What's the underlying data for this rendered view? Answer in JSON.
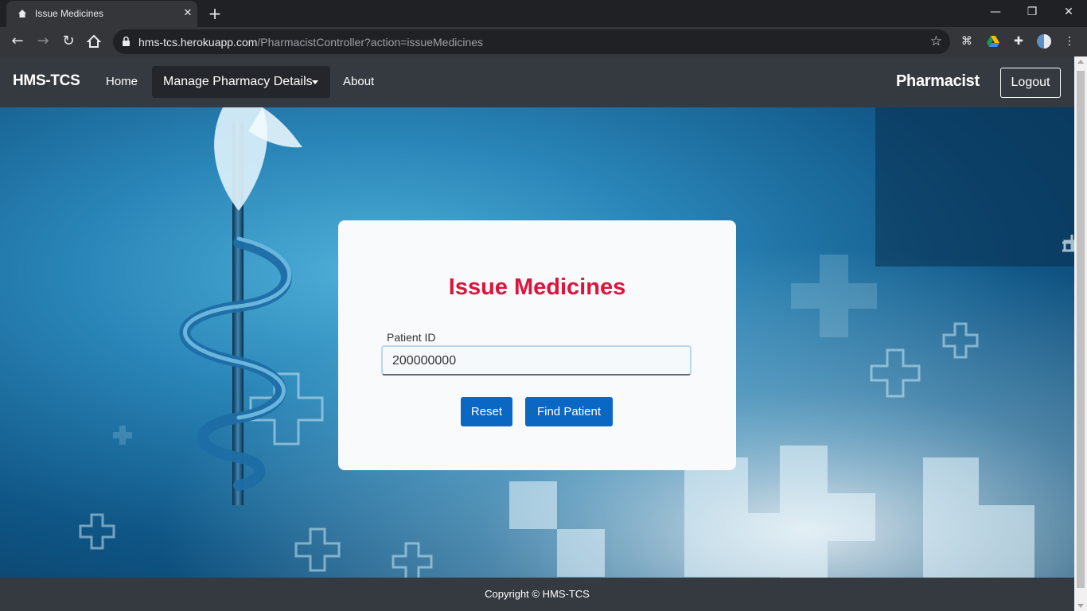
{
  "browser": {
    "tab_title": "Issue Medicines",
    "url_host": "hms-tcs.herokuapp.com",
    "url_path": "/PharmacistController?action=issueMedicines"
  },
  "navbar": {
    "brand": "HMS-TCS",
    "links": {
      "home": "Home",
      "manage": "Manage Pharmacy Details",
      "about": "About"
    },
    "role": "Pharmacist",
    "logout": "Logout"
  },
  "form": {
    "title": "Issue Medicines",
    "patient_id_label": "Patient ID",
    "patient_id_value": "200000000",
    "reset_label": "Reset",
    "find_label": "Find Patient"
  },
  "footer": {
    "copyright": "Copyright © HMS-TCS"
  },
  "colors": {
    "navbar": "#343a40",
    "title": "#dc143c",
    "button": "#0b67c4"
  }
}
